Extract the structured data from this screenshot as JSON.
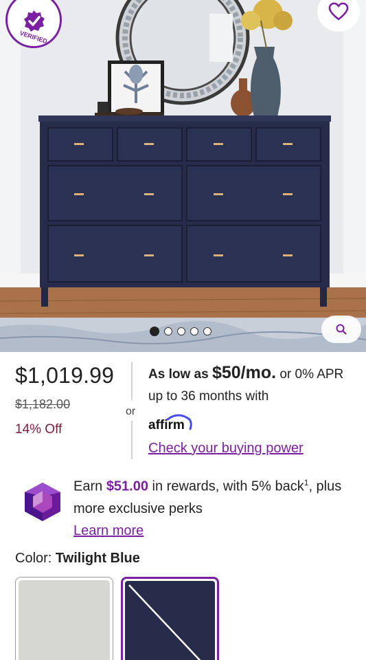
{
  "hero": {
    "badge_text": "WAYFAIR VERIFIED",
    "favorite_icon": "heart-icon",
    "zoom_icon": "search-icon",
    "gallery_count": 5,
    "gallery_active_index": 0
  },
  "price": {
    "current": "$1,019.99",
    "was": "$1,182.00",
    "discount": "14% Off",
    "or_text": "or"
  },
  "financing": {
    "as_low_as": "As low as",
    "monthly": "$50/mo.",
    "rest": "or 0% APR up to 36 months with",
    "affirm_logo": "affirm",
    "buying_power_link": "Check your buying power"
  },
  "rewards": {
    "earn": "Earn",
    "amount": "$51.00",
    "rest": "in rewards, with 5% back",
    "footnote": "1",
    "perks": ", plus more exclusive perks",
    "learn_more": "Learn more",
    "icon": "gem-icon"
  },
  "color": {
    "label": "Color:",
    "selected": "Twilight Blue",
    "options": [
      {
        "name": "gray",
        "hex": "#d6d6d2"
      },
      {
        "name": "Twilight Blue",
        "hex": "#262c4a"
      }
    ]
  },
  "colors": {
    "accent": "#7b1fa2",
    "discount": "#7a1c3c",
    "dresser": "#262c4a"
  }
}
